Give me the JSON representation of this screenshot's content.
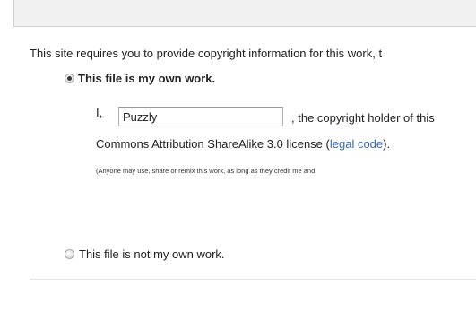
{
  "intro_text": "This site requires you to provide copyright information for this work, t",
  "own_work": {
    "label": "This file is my own work.",
    "selected": true
  },
  "license": {
    "prefix": "I,",
    "author_value": "Puzzly",
    "suffix": ", the copyright holder of this",
    "line2_text": "Commons Attribution ShareAlike 3.0 license (",
    "legal_code_link": "legal code",
    "line2_end": ").",
    "note": "(Anyone may use, share or remix this work, as long as they credit me and"
  },
  "not_own_work": {
    "label": "This file is not my own work.",
    "selected": false
  }
}
